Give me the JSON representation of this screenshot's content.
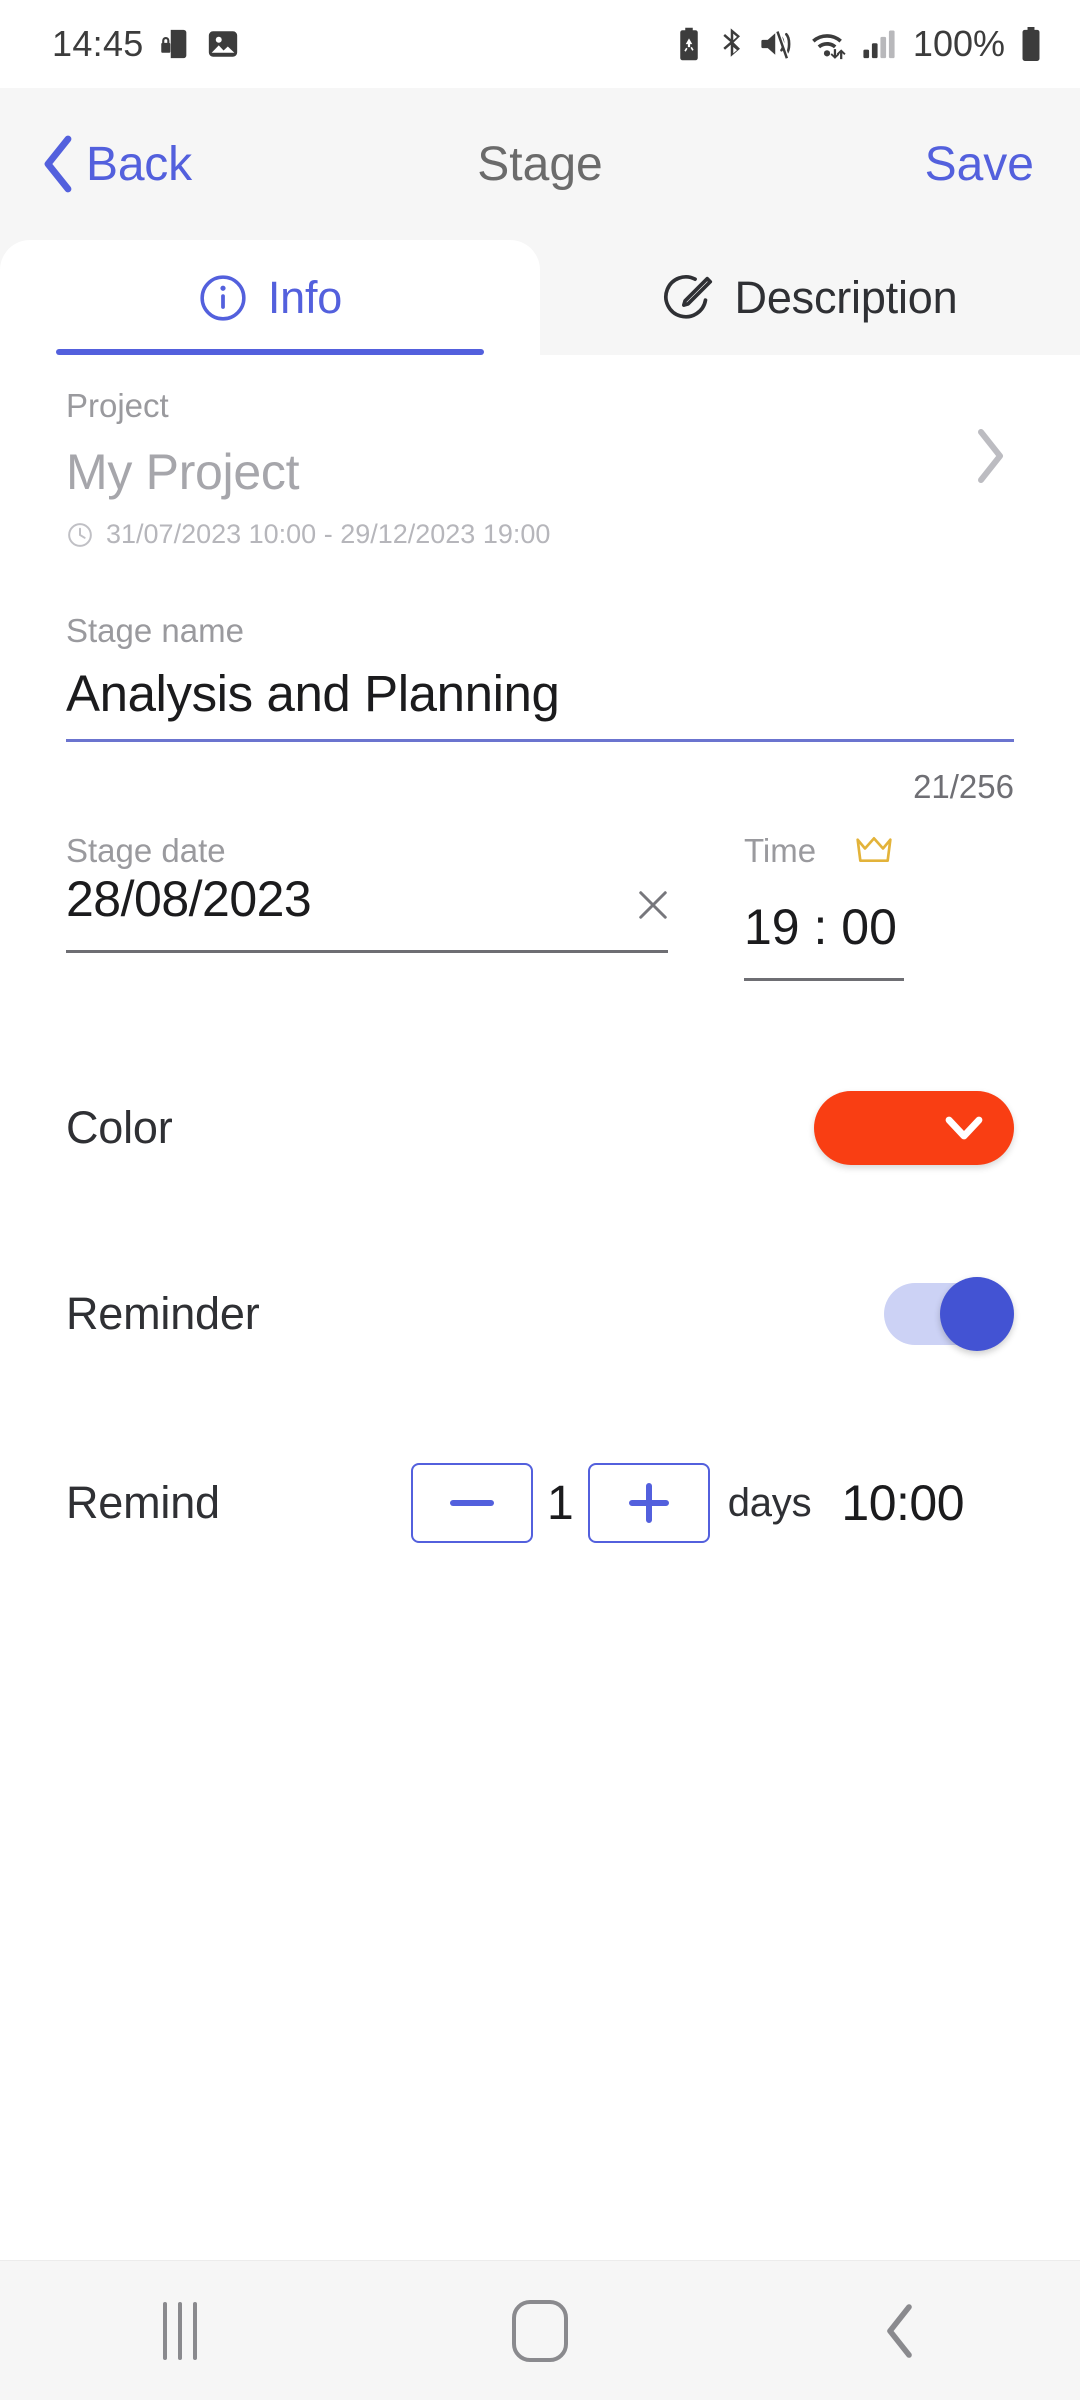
{
  "status_bar": {
    "time": "14:45",
    "battery_percent": "100%",
    "left_icons": [
      "sim-lock-icon",
      "gallery-icon"
    ],
    "right_icons": [
      "battery-saver-icon",
      "bluetooth-icon",
      "mute-icon",
      "wifi-icon",
      "signal-icon",
      "battery-icon"
    ]
  },
  "header": {
    "back_label": "Back",
    "title": "Stage",
    "save_label": "Save"
  },
  "tabs": [
    {
      "label": "Info",
      "icon": "info-circle-icon",
      "active": true
    },
    {
      "label": "Description",
      "icon": "edit-circle-icon",
      "active": false
    }
  ],
  "form": {
    "project": {
      "label": "Project",
      "value": "My Project",
      "dates": "31/07/2023 10:00 - 29/12/2023 19:00",
      "clock_icon": "clock-icon",
      "chevron_icon": "chevron-right-icon"
    },
    "stage_name": {
      "label": "Stage name",
      "value": "Analysis and Planning",
      "placeholder": "Stage name",
      "counter": "21/256"
    },
    "stage_date": {
      "label": "Stage date",
      "value": "28/08/2023",
      "clear_icon": "close-icon"
    },
    "time": {
      "label": "Time",
      "value": "19 : 00",
      "premium_icon": "crown-icon"
    },
    "color": {
      "label": "Color",
      "value": "#f93e13",
      "chevron_icon": "chevron-down-icon"
    },
    "reminder": {
      "label": "Reminder",
      "enabled": true
    },
    "remind": {
      "label": "Remind",
      "minus_label": "−",
      "count": "1",
      "plus_label": "+",
      "unit": "days",
      "time": "10:00"
    }
  },
  "nav_bar": {
    "recents": "recents-icon",
    "home": "home-icon",
    "back": "back-icon"
  },
  "colors": {
    "accent": "#5360dd",
    "stage_color": "#f93e13",
    "toggle_on": "#4353d3"
  }
}
